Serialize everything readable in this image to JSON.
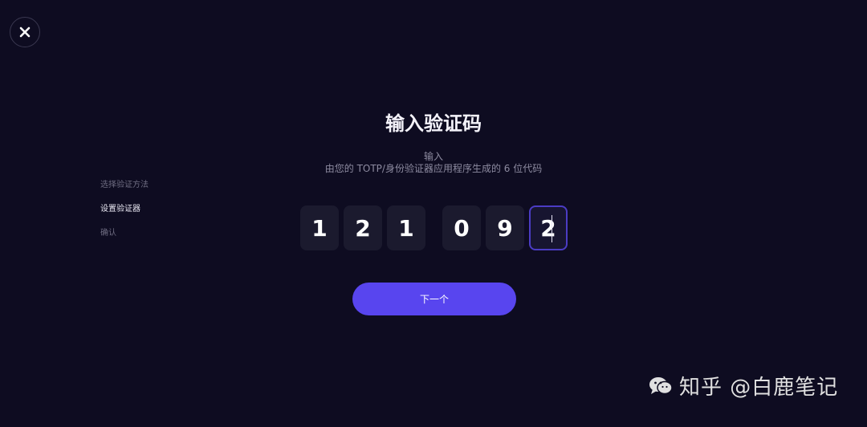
{
  "close_icon": "close-icon",
  "steps": [
    {
      "label": "选择验证方法",
      "state": "done"
    },
    {
      "label": "设置验证器",
      "state": "current"
    },
    {
      "label": "确认",
      "state": "pending"
    }
  ],
  "main": {
    "title": "输入验证码",
    "subtitle_line1": "输入",
    "subtitle_line2": "由您的 TOTP/身份验证器应用程序生成的 6 位代码",
    "code_digits": [
      "1",
      "2",
      "1",
      "0",
      "9",
      "2"
    ],
    "next_label": "下一个"
  },
  "watermark": {
    "text": "知乎 @白鹿笔记",
    "icon": "wechat-icon"
  },
  "colors": {
    "background": "#0e0c21",
    "accent": "#5845ef",
    "digit_box": "#1b1a2e"
  }
}
